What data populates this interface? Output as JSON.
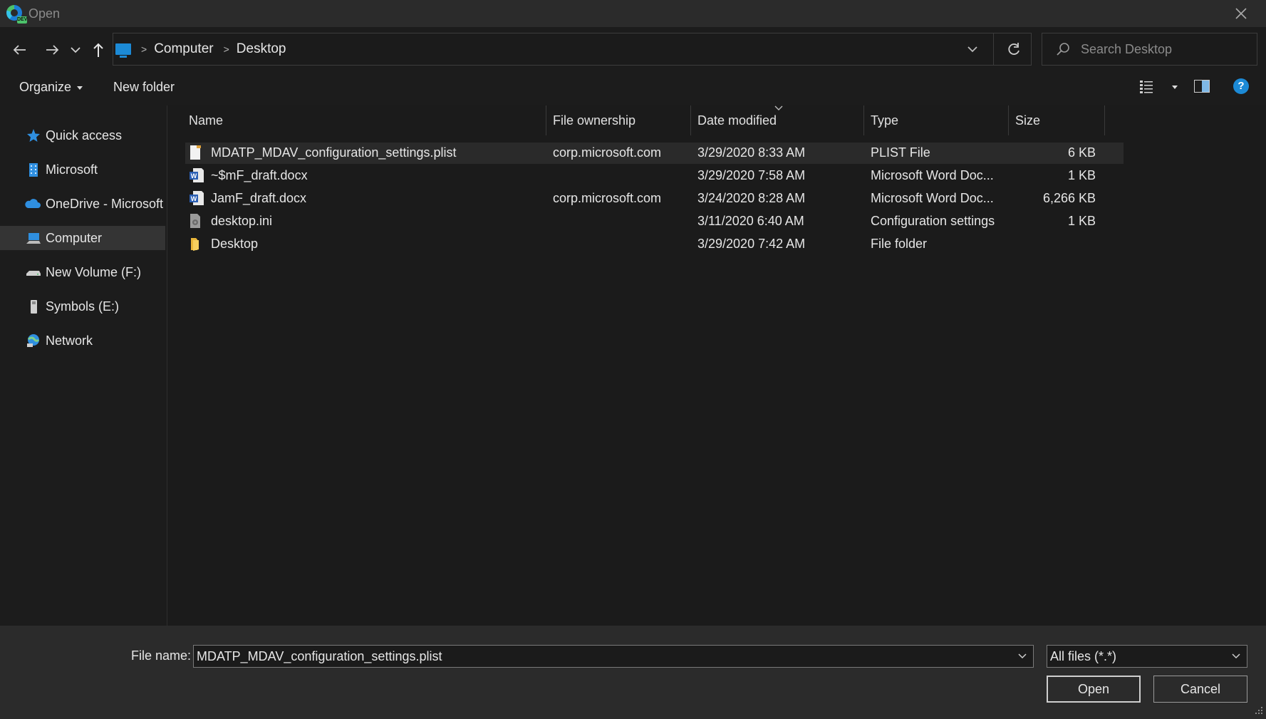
{
  "window": {
    "title": "Open",
    "close_icon": "close-icon"
  },
  "address": {
    "crumbs": [
      "Computer",
      "Desktop"
    ],
    "search_placeholder": "Search Desktop"
  },
  "toolbar": {
    "organize_label": "Organize",
    "new_folder_label": "New folder",
    "help_label": "?"
  },
  "sidebar": {
    "items": [
      {
        "label": "Quick access",
        "icon": "star-icon"
      },
      {
        "label": "Microsoft",
        "icon": "building-icon"
      },
      {
        "label": "OneDrive - Microsoft",
        "icon": "cloud-icon"
      },
      {
        "label": "Computer",
        "icon": "computer-icon",
        "selected": true
      },
      {
        "label": "New Volume (F:)",
        "icon": "drive-icon"
      },
      {
        "label": "Symbols (E:)",
        "icon": "usb-drive-icon"
      },
      {
        "label": "Network",
        "icon": "network-icon"
      }
    ]
  },
  "columns": {
    "name": "Name",
    "ownership": "File ownership",
    "date": "Date modified",
    "type": "Type",
    "size": "Size"
  },
  "files": [
    {
      "name": "MDATP_MDAV_configuration_settings.plist",
      "ownership": "corp.microsoft.com",
      "date": "3/29/2020 8:33 AM",
      "type": "PLIST File",
      "size": "6 KB",
      "icon": "plist-file-icon",
      "selected": true
    },
    {
      "name": "~$mF_draft.docx",
      "ownership": "",
      "date": "3/29/2020 7:58 AM",
      "type": "Microsoft Word Doc...",
      "size": "1 KB",
      "icon": "word-doc-icon"
    },
    {
      "name": "JamF_draft.docx",
      "ownership": "corp.microsoft.com",
      "date": "3/24/2020 8:28 AM",
      "type": "Microsoft Word Doc...",
      "size": "6,266 KB",
      "icon": "word-doc-icon"
    },
    {
      "name": "desktop.ini",
      "ownership": "",
      "date": "3/11/2020 6:40 AM",
      "type": "Configuration settings",
      "size": "1 KB",
      "icon": "settings-file-icon"
    },
    {
      "name": "Desktop",
      "ownership": "",
      "date": "3/29/2020 7:42 AM",
      "type": "File folder",
      "size": "",
      "icon": "folder-icon"
    }
  ],
  "footer": {
    "file_name_label": "File name:",
    "file_name_value": "MDATP_MDAV_configuration_settings.plist",
    "file_type_value": "All files (*.*)",
    "open_label": "Open",
    "cancel_label": "Cancel"
  },
  "colors": {
    "accent": "#1c8ad6",
    "background": "#1b1b1b",
    "selected_row": "#2a2a2a"
  }
}
